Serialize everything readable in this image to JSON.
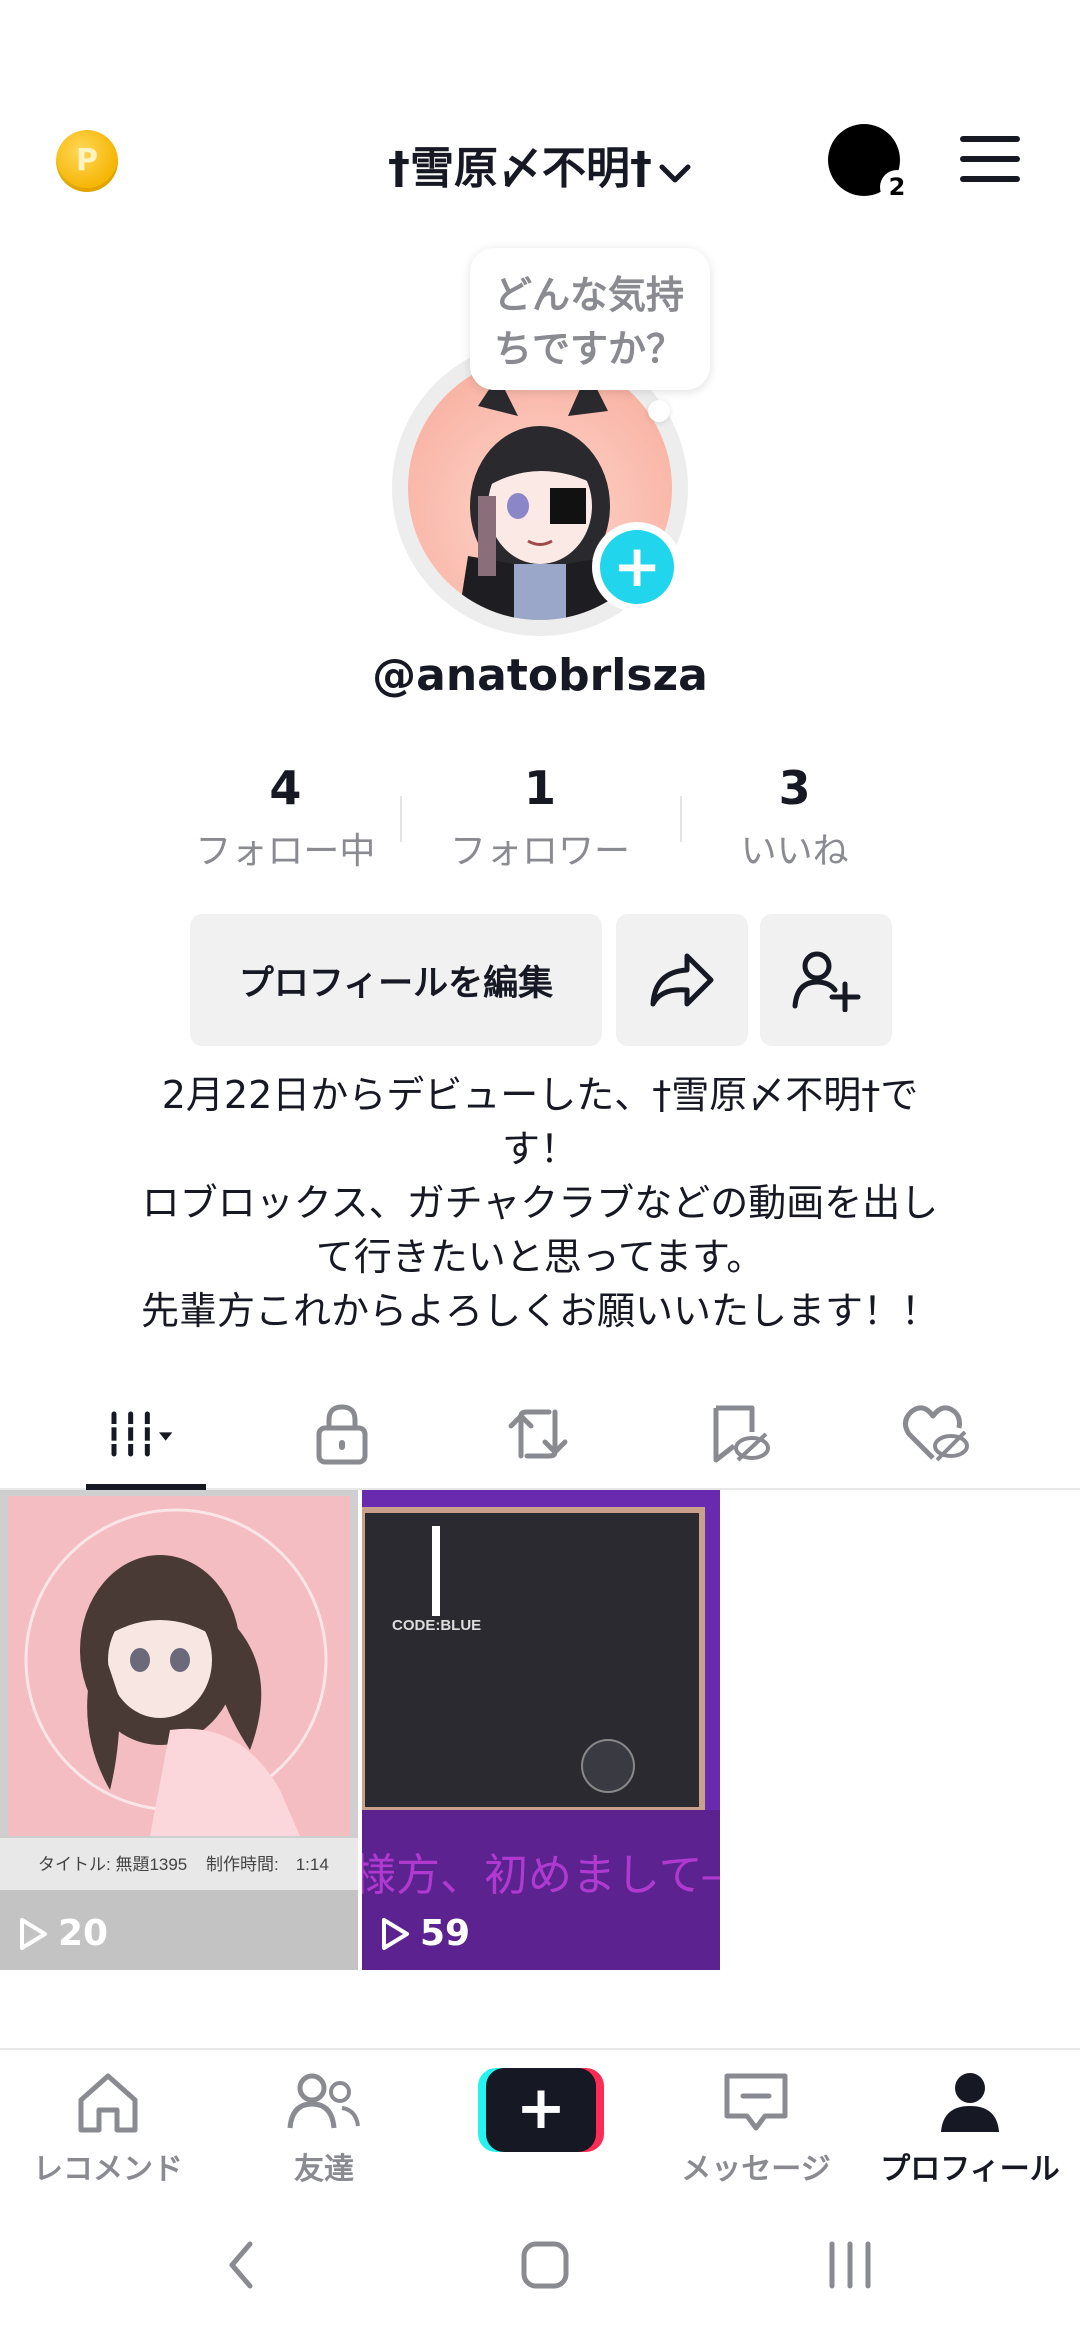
{
  "header": {
    "coin_label": "P",
    "title": "†雪原〆不明†",
    "notification_count": "2"
  },
  "profile": {
    "bubble_text_line1": "どんな気持",
    "bubble_text_line2": "ちですか？",
    "add_symbol": "+",
    "username": "@anatobrlsza"
  },
  "stats": [
    {
      "value": "4",
      "label": "フォロー中"
    },
    {
      "value": "1",
      "label": "フォロワー"
    },
    {
      "value": "3",
      "label": "いいね"
    }
  ],
  "buttons": {
    "edit_profile": "プロフィールを編集"
  },
  "bio": {
    "line1": "2月22日からデビューした、†雪原〆不明†で",
    "line2": "す！",
    "line3": "ロブロックス、ガチャクラブなどの動画を出し",
    "line4": "て行きたいと思ってます。",
    "line5": "先輩方これからよろしくお願いいたします！！"
  },
  "videos": [
    {
      "views": "20",
      "caption_title": "タイトル: 無題1395",
      "caption_time": "制作時間:　1:14"
    },
    {
      "views": "59",
      "overlay_code": "CODE:BLUE",
      "overlay_caption": "様方、初めまして―"
    }
  ],
  "nav": {
    "home": "レコメンド",
    "friends": "友達",
    "create": "+",
    "messages": "メッセージ",
    "profile": "プロフィール"
  },
  "colors": {
    "accent_cyan": "#25f4ee",
    "accent_red": "#fe2c55",
    "add_button": "#20d5ec",
    "text_primary": "#161823",
    "text_secondary": "#8a8b91"
  }
}
